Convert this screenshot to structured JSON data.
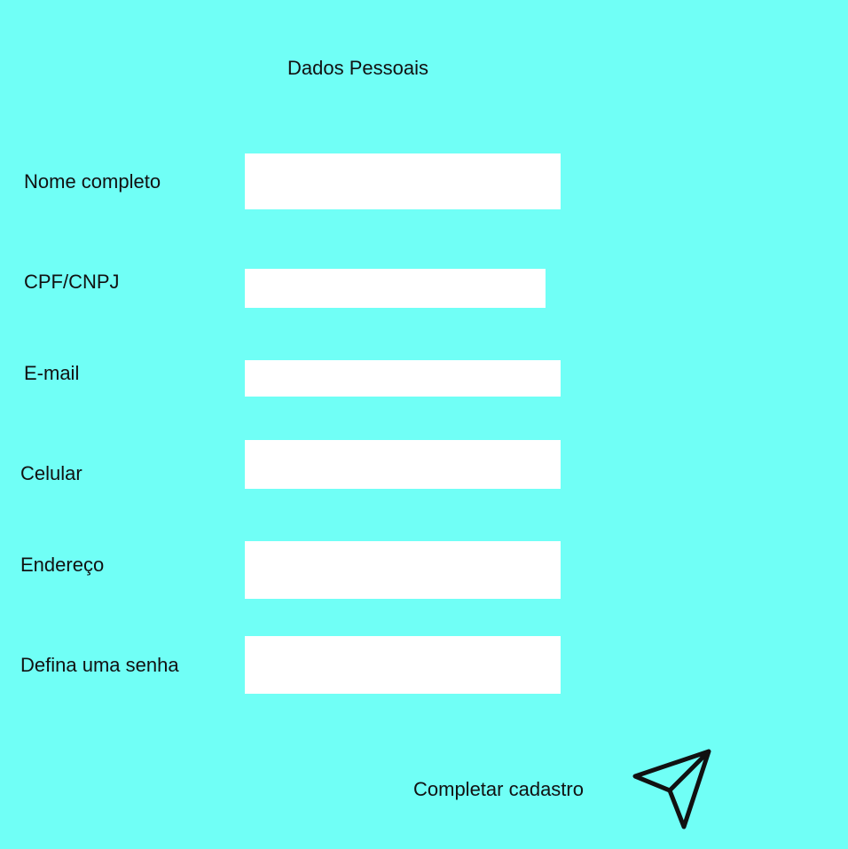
{
  "page": {
    "title": "Dados Pessoais",
    "background_color": "#70fff6"
  },
  "form": {
    "fields": [
      {
        "label": "Nome completo",
        "value": "",
        "placeholder": ""
      },
      {
        "label": "CPF/CNPJ",
        "value": "",
        "placeholder": ""
      },
      {
        "label": "E-mail",
        "value": "",
        "placeholder": ""
      },
      {
        "label": "Celular",
        "value": "",
        "placeholder": ""
      },
      {
        "label": "Endereço",
        "value": "",
        "placeholder": ""
      },
      {
        "label": "Defina uma senha",
        "value": "",
        "placeholder": ""
      }
    ],
    "submit": {
      "label": "Completar cadastro",
      "icon": "send-icon"
    }
  }
}
